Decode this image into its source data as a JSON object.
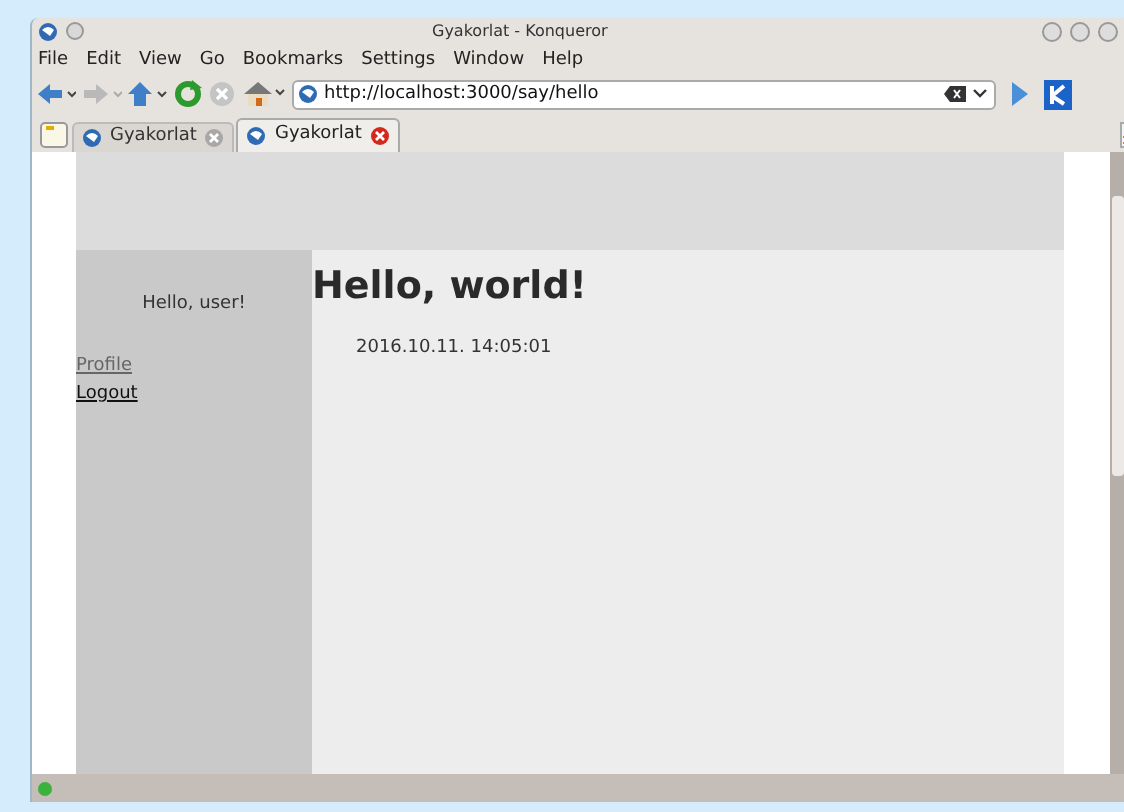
{
  "window": {
    "title": "Gyakorlat - Konqueror"
  },
  "menu": [
    "File",
    "Edit",
    "View",
    "Go",
    "Bookmarks",
    "Settings",
    "Window",
    "Help"
  ],
  "address": {
    "value": "http://localhost:3000/say/hello"
  },
  "tabs": [
    {
      "label": "Gyakorlat",
      "selected": false
    },
    {
      "label": "Gyakorlat",
      "selected": true
    }
  ],
  "page": {
    "greeting": "Hello, user!",
    "links": [
      "Profile",
      "Logout"
    ],
    "heading": "Hello, world!",
    "timestamp": "2016.10.11. 14:05:01"
  }
}
